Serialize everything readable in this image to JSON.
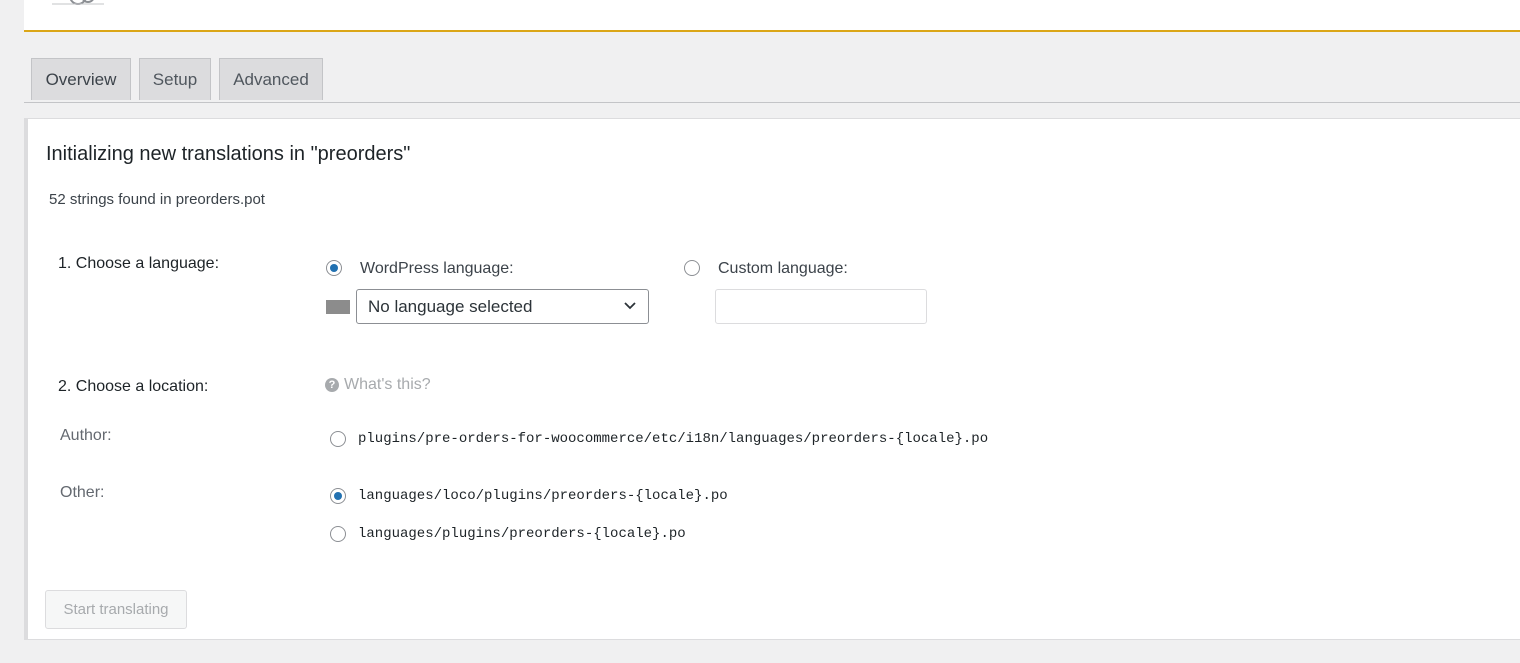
{
  "tabs": [
    {
      "label": "Overview",
      "active": true
    },
    {
      "label": "Setup",
      "active": false
    },
    {
      "label": "Advanced",
      "active": false
    }
  ],
  "panel": {
    "title": "Initializing new translations in \"preorders\"",
    "subtext": "52 strings found in preorders.pot"
  },
  "language": {
    "heading": "1. Choose a language:",
    "wordpress_label": "WordPress language:",
    "wordpress_checked": true,
    "select_value": "No language selected",
    "custom_label": "Custom language:",
    "custom_checked": false,
    "custom_value": ""
  },
  "location": {
    "heading": "2. Choose a location:",
    "help_label": "What's this?",
    "author_label": "Author:",
    "author_options": [
      {
        "path": "plugins/pre-orders-for-woocommerce/etc/i18n/languages/preorders-{locale}.po",
        "checked": false
      }
    ],
    "other_label": "Other:",
    "other_options": [
      {
        "path": "languages/loco/plugins/preorders-{locale}.po",
        "checked": true
      },
      {
        "path": "languages/plugins/preorders-{locale}.po",
        "checked": false
      }
    ]
  },
  "submit": {
    "label": "Start translating",
    "disabled": true
  },
  "colors": {
    "accent": "#2271b1",
    "notice_border": "#dba617"
  },
  "icons": {
    "help": "question-circle-icon",
    "dropdown": "chevron-down-icon",
    "flag": "flag-placeholder-icon"
  }
}
